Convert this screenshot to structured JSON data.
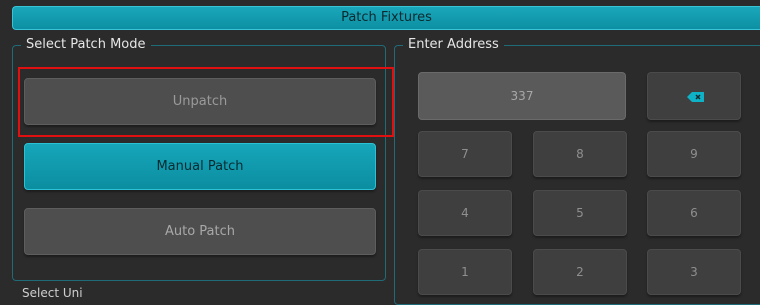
{
  "title": "Patch Fixtures",
  "left_panel": {
    "label": "Select Patch Mode",
    "buttons": {
      "unpatch": "Unpatch",
      "manual": "Manual Patch",
      "auto": "Auto Patch"
    },
    "next_label": "Select Uni"
  },
  "right_panel": {
    "label": "Enter Address",
    "address_value": "337",
    "keys": [
      "7",
      "8",
      "9",
      "4",
      "5",
      "6",
      "1",
      "2",
      "3"
    ]
  },
  "colors": {
    "accent": "#12a0b4",
    "highlight": "#e01010",
    "background": "#2b2b2b"
  },
  "icons": {
    "backspace": "backspace-icon"
  }
}
